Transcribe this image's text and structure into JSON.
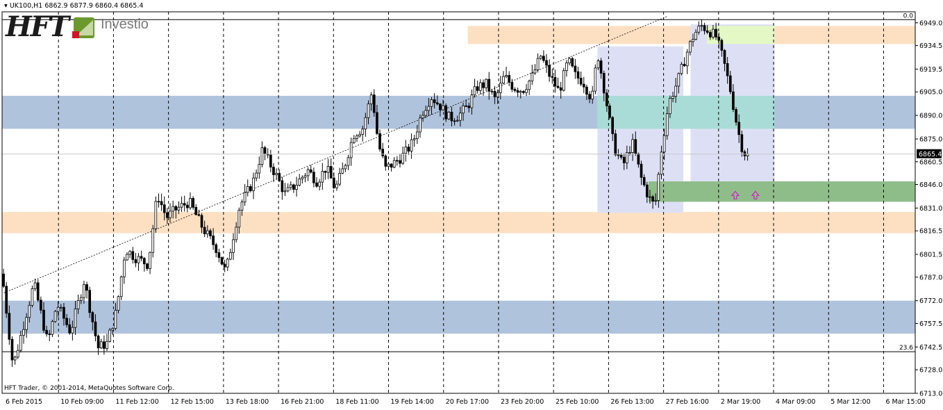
{
  "header": {
    "symbol_line": "UK100,H1  6862.9 6877.9 6860.4 6865.4"
  },
  "logo": {
    "mark": "HFT",
    "brand": "Investio"
  },
  "copyright": "HFT Trader, © 2001-2014, MetaQuotes Software Corp.",
  "chart_data": {
    "type": "candlestick",
    "symbol": "UK100",
    "timeframe": "H1",
    "ylim": [
      6713.0,
      6956.0
    ],
    "y_ticks": [
      "6949.0",
      "6934.5",
      "6919.5",
      "6905.0",
      "6890.0",
      "6875.0",
      "6860.5",
      "6846.0",
      "6831.0",
      "6816.5",
      "6801.5",
      "6787.0",
      "6772.0",
      "6757.5",
      "6742.5",
      "6728.0",
      "6713.0"
    ],
    "x_labels": [
      "6 Feb 2015",
      "10 Feb 09:00",
      "11 Feb 12:00",
      "12 Feb 15:00",
      "13 Feb 18:00",
      "16 Feb 21:00",
      "18 Feb 11:00",
      "19 Feb 14:00",
      "20 Feb 17:00",
      "23 Feb 20:00",
      "25 Feb 10:00",
      "26 Feb 13:00",
      "27 Feb 16:00",
      "2 Mar 19:00",
      "4 Mar 09:00",
      "5 Mar 12:00",
      "6 Mar 15:00"
    ],
    "current_price": "6865.4",
    "fibonacci": [
      {
        "label": "0.0",
        "price": 6951.0
      },
      {
        "label": "23.6",
        "price": 6739.5
      }
    ],
    "zones": [
      {
        "kind": "supply",
        "from": 6935.5,
        "to": 6947.0,
        "start": 0.51,
        "end": 1.0,
        "color": "#fde0c2"
      },
      {
        "kind": "resistance",
        "from": 6881.5,
        "to": 6902.5,
        "start": 0.0,
        "end": 1.0,
        "color": "#b0c3dc"
      },
      {
        "kind": "support",
        "from": 6815.0,
        "to": 6828.5,
        "start": 0.0,
        "end": 1.0,
        "color": "#fde0c2"
      },
      {
        "kind": "support",
        "from": 6751.0,
        "to": 6772.0,
        "start": 0.0,
        "end": 1.0,
        "color": "#b0c3dc"
      }
    ],
    "highlight_boxes": [
      {
        "from": 6828.0,
        "to": 6934.0,
        "start": 0.652,
        "end": 0.746,
        "color": "#dde0f5"
      },
      {
        "from": 6847.5,
        "to": 6948.0,
        "start": 0.754,
        "end": 0.846,
        "color": "#dde0f5"
      },
      {
        "from": 6935.5,
        "to": 6947.0,
        "start": 0.772,
        "end": 0.846,
        "color": "#e3f8c4"
      },
      {
        "from": 6881.5,
        "to": 6902.5,
        "start": 0.652,
        "end": 0.846,
        "color": "#a9dcd6"
      },
      {
        "from": 6835.0,
        "to": 6848.0,
        "start": 0.708,
        "end": 1.0,
        "color": "#8fbd8a"
      }
    ],
    "trendline": {
      "x1": 0.002,
      "y1": 6777.0,
      "x2": 0.728,
      "y2": 6953.0
    },
    "signals": [
      {
        "kind": "up-arrow",
        "x": 0.803,
        "price": 6839.0
      },
      {
        "kind": "up-arrow",
        "x": 0.825,
        "price": 6839.0
      }
    ],
    "path": [
      [
        0.0,
        6789
      ],
      [
        0.012,
        6730
      ],
      [
        0.025,
        6760
      ],
      [
        0.035,
        6783
      ],
      [
        0.05,
        6745
      ],
      [
        0.06,
        6770
      ],
      [
        0.075,
        6752
      ],
      [
        0.09,
        6785
      ],
      [
        0.105,
        6742
      ],
      [
        0.115,
        6745
      ],
      [
        0.125,
        6765
      ],
      [
        0.135,
        6805
      ],
      [
        0.145,
        6800
      ],
      [
        0.16,
        6795
      ],
      [
        0.17,
        6840
      ],
      [
        0.18,
        6825
      ],
      [
        0.19,
        6830
      ],
      [
        0.205,
        6835
      ],
      [
        0.22,
        6818
      ],
      [
        0.235,
        6805
      ],
      [
        0.245,
        6790
      ],
      [
        0.252,
        6810
      ],
      [
        0.26,
        6832
      ],
      [
        0.275,
        6848
      ],
      [
        0.285,
        6868
      ],
      [
        0.3,
        6852
      ],
      [
        0.31,
        6840
      ],
      [
        0.32,
        6845
      ],
      [
        0.335,
        6855
      ],
      [
        0.345,
        6848
      ],
      [
        0.355,
        6857
      ],
      [
        0.365,
        6843
      ],
      [
        0.375,
        6858
      ],
      [
        0.385,
        6878
      ],
      [
        0.395,
        6882
      ],
      [
        0.405,
        6905
      ],
      [
        0.412,
        6872
      ],
      [
        0.42,
        6856
      ],
      [
        0.43,
        6860
      ],
      [
        0.44,
        6865
      ],
      [
        0.45,
        6873
      ],
      [
        0.46,
        6892
      ],
      [
        0.47,
        6902
      ],
      [
        0.48,
        6896
      ],
      [
        0.49,
        6888
      ],
      [
        0.5,
        6890
      ],
      [
        0.51,
        6896
      ],
      [
        0.52,
        6908
      ],
      [
        0.53,
        6910
      ],
      [
        0.54,
        6900
      ],
      [
        0.55,
        6915
      ],
      [
        0.56,
        6908
      ],
      [
        0.57,
        6906
      ],
      [
        0.58,
        6914
      ],
      [
        0.59,
        6928
      ],
      [
        0.6,
        6915
      ],
      [
        0.61,
        6905
      ],
      [
        0.62,
        6925
      ],
      [
        0.628,
        6915
      ],
      [
        0.636,
        6912
      ],
      [
        0.646,
        6900
      ],
      [
        0.652,
        6930
      ],
      [
        0.66,
        6905
      ],
      [
        0.67,
        6870
      ],
      [
        0.68,
        6858
      ],
      [
        0.69,
        6873
      ],
      [
        0.7,
        6850
      ],
      [
        0.708,
        6838
      ],
      [
        0.715,
        6832
      ],
      [
        0.722,
        6868
      ],
      [
        0.73,
        6898
      ],
      [
        0.74,
        6912
      ],
      [
        0.75,
        6930
      ],
      [
        0.758,
        6942
      ],
      [
        0.766,
        6947
      ],
      [
        0.774,
        6944
      ],
      [
        0.782,
        6940
      ],
      [
        0.79,
        6925
      ],
      [
        0.798,
        6905
      ],
      [
        0.806,
        6880
      ],
      [
        0.812,
        6866
      ],
      [
        0.818,
        6866
      ]
    ]
  }
}
